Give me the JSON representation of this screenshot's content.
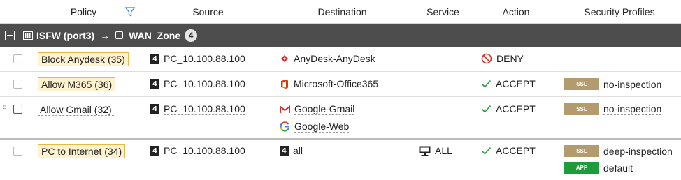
{
  "columns": {
    "policy": "Policy",
    "source": "Source",
    "destination": "Destination",
    "service": "Service",
    "action": "Action",
    "security_profiles": "Security Profiles"
  },
  "group": {
    "source_interface": "ISFW (port3)",
    "arrow": "→",
    "dest_interface": "WAN_Zone",
    "count": "4"
  },
  "rows": [
    {
      "policy": "Block Anydesk (35)",
      "source": "PC_10.100.88.100",
      "destination": [
        "AnyDesk-AnyDesk"
      ],
      "service": "",
      "action": "DENY",
      "profiles": []
    },
    {
      "policy": "Allow M365 (36)",
      "source": "PC_10.100.88.100",
      "destination": [
        "Microsoft-Office365"
      ],
      "service": "",
      "action": "ACCEPT",
      "profiles": [
        {
          "badge": "SSL",
          "name": "no-inspection"
        }
      ]
    },
    {
      "policy": "Allow Gmail (32)",
      "source": "PC_10.100.88.100",
      "destination": [
        "Google-Gmail",
        "Google-Web"
      ],
      "service": "",
      "action": "ACCEPT",
      "profiles": [
        {
          "badge": "SSL",
          "name": "no-inspection"
        }
      ]
    },
    {
      "policy": "PC to Internet (34)",
      "source": "PC_10.100.88.100",
      "destination": [
        "all"
      ],
      "service": "ALL",
      "action": "ACCEPT",
      "profiles": [
        {
          "badge": "SSL",
          "name": "deep-inspection"
        },
        {
          "badge": "APP",
          "name": "default"
        }
      ]
    }
  ],
  "address_icon_glyph": "4",
  "colors": {
    "group_bar": "#4d4d4d",
    "highlight_fill": "#fff3cf",
    "highlight_border": "#e6b84a",
    "accept_green": "#2e9a44",
    "deny_red": "#d9302c",
    "ssl_badge": "#b49b6e",
    "app_badge": "#1e9c3b"
  }
}
